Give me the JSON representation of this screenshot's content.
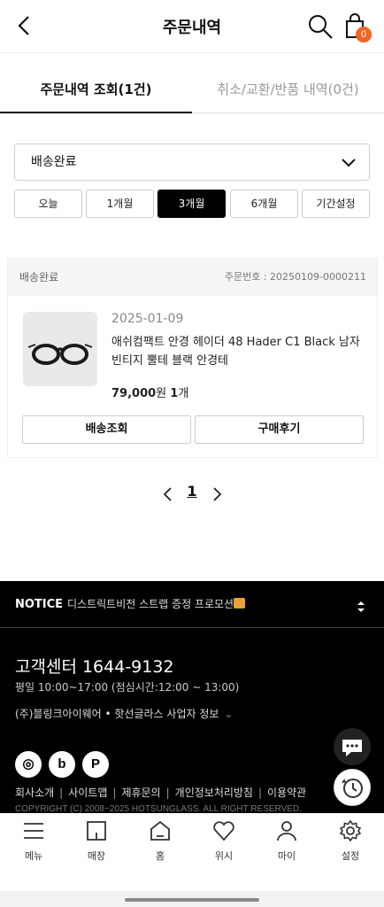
{
  "header": {
    "title": "주문내역",
    "cart_count": "0",
    "accent_color": "#f26522"
  },
  "tabs": [
    {
      "label": "주문내역 조회(1건)",
      "active": true
    },
    {
      "label": "취소/교환/반품 내역(0건)",
      "active": false
    }
  ],
  "filter": {
    "status_value": "배송완료",
    "periods": [
      "오늘",
      "1개월",
      "3개월",
      "6개월",
      "기간설정"
    ],
    "selected_period": "3개월"
  },
  "order": {
    "status": "배송완료",
    "order_number": "주문번호 : 20250109-0000211",
    "date": "2025-01-09",
    "product_name": "애쉬컴팩트 안경 헤이더 48 Hader C1 Black 남자 빈티지 뿔테 블랙 안경테",
    "price": "79,000",
    "price_unit": "원",
    "quantity": "1",
    "quantity_unit": "개",
    "buttons": [
      "배송조회",
      "구매후기"
    ]
  },
  "pagination": {
    "current": "1"
  },
  "footer": {
    "notice_label": "NOTICE",
    "notice_text": "디스트릭트비전 스트랩 증정 프로모션",
    "cs_title": "고객센터 1644-9132",
    "cs_hours": "평일 10:00~17:00 (점심시간:12:00 ~ 13:00)",
    "business_info": "(주)블링크아이웨어 • 핫선글라스 사업자 정보",
    "sns": [
      "instagram-icon",
      "blog-icon",
      "kakao-icon"
    ],
    "links": [
      "회사소개",
      "사이트맵",
      "제휴문의",
      "개인정보처리방침",
      "이용약관"
    ],
    "copyright": "COPYRIGHT (C) 2008~2025 HOTSUNGLASS. ALL RIGHT RESERVED."
  },
  "bottom_nav": [
    {
      "label": "메뉴",
      "icon": "menu-icon"
    },
    {
      "label": "매장",
      "icon": "store-icon"
    },
    {
      "label": "홈",
      "icon": "home-icon"
    },
    {
      "label": "위시",
      "icon": "heart-icon"
    },
    {
      "label": "마이",
      "icon": "user-icon"
    },
    {
      "label": "설정",
      "icon": "gear-icon"
    }
  ]
}
